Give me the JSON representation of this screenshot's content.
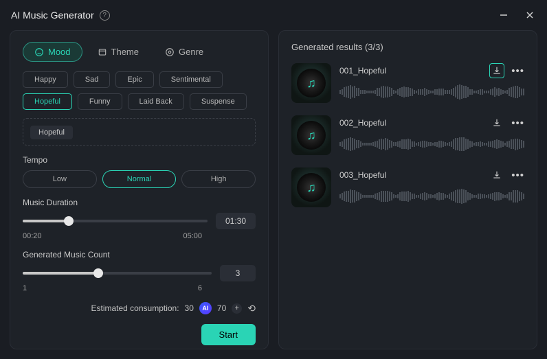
{
  "title": "AI Music Generator",
  "tabs": [
    {
      "label": "Mood",
      "active": true
    },
    {
      "label": "Theme",
      "active": false
    },
    {
      "label": "Genre",
      "active": false
    }
  ],
  "moods": [
    {
      "label": "Happy",
      "selected": false
    },
    {
      "label": "Sad",
      "selected": false
    },
    {
      "label": "Epic",
      "selected": false
    },
    {
      "label": "Sentimental",
      "selected": false
    },
    {
      "label": "Hopeful",
      "selected": true
    },
    {
      "label": "Funny",
      "selected": false
    },
    {
      "label": "Laid Back",
      "selected": false
    },
    {
      "label": "Suspense",
      "selected": false
    }
  ],
  "selected_tag": "Hopeful",
  "tempo": {
    "label": "Tempo",
    "options": [
      "Low",
      "Normal",
      "High"
    ],
    "selected": "Normal"
  },
  "duration": {
    "label": "Music Duration",
    "min_label": "00:20",
    "max_label": "05:00",
    "value": "01:30",
    "percent": 25
  },
  "count": {
    "label": "Generated Music Count",
    "min_label": "1",
    "max_label": "6",
    "value": "3",
    "percent": 40
  },
  "consumption": {
    "label": "Estimated consumption:",
    "cost": "30",
    "balance": "70"
  },
  "start_label": "Start",
  "results": {
    "title": "Generated results (3/3)",
    "items": [
      {
        "name": "001_Hopeful",
        "highlighted": true
      },
      {
        "name": "002_Hopeful",
        "highlighted": false
      },
      {
        "name": "003_Hopeful",
        "highlighted": false
      }
    ]
  }
}
